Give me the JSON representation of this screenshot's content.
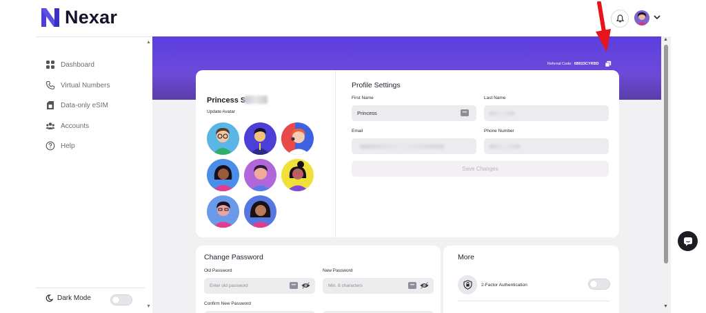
{
  "brand": {
    "name": "Nexar",
    "color": "#4b3fd8"
  },
  "header": {
    "notification_icon": "bell-icon",
    "avatar_dropdown_icon": "chevron-down-icon"
  },
  "sidebar": {
    "items": [
      {
        "label": "Dashboard",
        "icon": "grid-icon"
      },
      {
        "label": "Virtual Numbers",
        "icon": "phone-icon"
      },
      {
        "label": "Data-only eSIM",
        "icon": "sim-icon"
      },
      {
        "label": "Accounts",
        "icon": "users-icon"
      },
      {
        "label": "Help",
        "icon": "help-icon"
      }
    ],
    "dark_mode_label": "Dark Mode",
    "dark_mode_on": false
  },
  "referral": {
    "label": "Referral Code:",
    "code": "6B023CYRBD"
  },
  "profile": {
    "name": "Princess S",
    "update_avatar_label": "Update Avatar",
    "avatar_count": 8
  },
  "profile_settings": {
    "title": "Profile Settings",
    "first_name_label": "First Name",
    "first_name_value": "Princess",
    "last_name_label": "Last Name",
    "email_label": "Email",
    "phone_label": "Phone Number",
    "save_label": "Save Changes"
  },
  "change_password": {
    "title": "Change Password",
    "old_label": "Old Password",
    "old_placeholder": "Enter old password",
    "new_label": "New Password",
    "new_placeholder": "Min. 8 characters",
    "confirm_label": "Confirm New Password"
  },
  "more": {
    "title": "More",
    "tfa_label": "2-Factor Authentication",
    "tfa_on": false
  },
  "colors": {
    "banner": "#5b3ee0",
    "annotation_arrow": "#e8141b"
  }
}
